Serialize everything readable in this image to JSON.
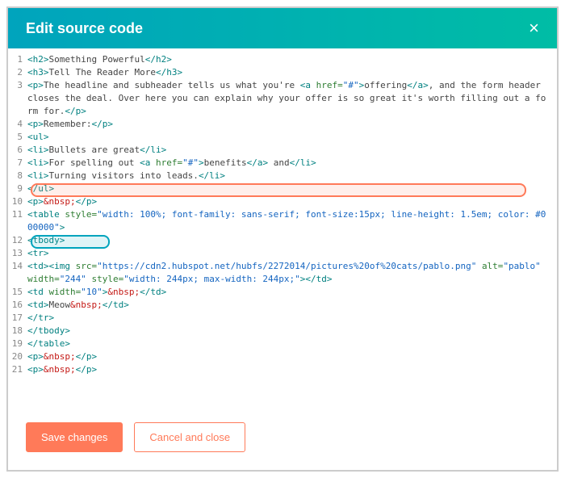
{
  "header": {
    "title": "Edit source code",
    "closeGlyph": "×"
  },
  "buttons": {
    "save": "Save changes",
    "cancel": "Cancel and close"
  },
  "code": {
    "lines": [
      {
        "n": "1",
        "tokens": [
          {
            "c": "t-tag",
            "t": "<h2>"
          },
          {
            "c": "t-text",
            "t": "Something Powerful"
          },
          {
            "c": "t-tag",
            "t": "</h2>"
          }
        ]
      },
      {
        "n": "2",
        "tokens": [
          {
            "c": "t-tag",
            "t": "<h3>"
          },
          {
            "c": "t-text",
            "t": "Tell The Reader More"
          },
          {
            "c": "t-tag",
            "t": "</h3>"
          }
        ]
      },
      {
        "n": "3",
        "tokens": [
          {
            "c": "t-tag",
            "t": "<p>"
          },
          {
            "c": "t-text",
            "t": "The headline and subheader tells us what you're "
          },
          {
            "c": "t-tag",
            "t": "<a "
          },
          {
            "c": "t-attr",
            "t": "href="
          },
          {
            "c": "t-val",
            "t": "\"#\""
          },
          {
            "c": "t-tag",
            "t": ">"
          },
          {
            "c": "t-text",
            "t": "offering"
          },
          {
            "c": "t-tag",
            "t": "</a>"
          },
          {
            "c": "t-text",
            "t": ", and the form header closes the deal. Over here you can explain why your offer is so great it's worth filling out a form for."
          },
          {
            "c": "t-tag",
            "t": "</p>"
          }
        ]
      },
      {
        "n": "4",
        "tokens": [
          {
            "c": "t-tag",
            "t": "<p>"
          },
          {
            "c": "t-text",
            "t": "Remember:"
          },
          {
            "c": "t-tag",
            "t": "</p>"
          }
        ]
      },
      {
        "n": "5",
        "tokens": [
          {
            "c": "t-tag",
            "t": "<ul>"
          }
        ]
      },
      {
        "n": "6",
        "tokens": [
          {
            "c": "t-tag",
            "t": "<li>"
          },
          {
            "c": "t-text",
            "t": "Bullets are great"
          },
          {
            "c": "t-tag",
            "t": "</li>"
          }
        ]
      },
      {
        "n": "7",
        "tokens": [
          {
            "c": "t-tag",
            "t": "<li>"
          },
          {
            "c": "t-text",
            "t": "For spelling out "
          },
          {
            "c": "t-tag",
            "t": "<a "
          },
          {
            "c": "t-attr",
            "t": "href="
          },
          {
            "c": "t-val",
            "t": "\"#\""
          },
          {
            "c": "t-tag",
            "t": ">"
          },
          {
            "c": "t-text",
            "t": "benefits"
          },
          {
            "c": "t-tag",
            "t": "</a>"
          },
          {
            "c": "t-text",
            "t": " and"
          },
          {
            "c": "t-tag",
            "t": "</li>"
          }
        ]
      },
      {
        "n": "8",
        "tokens": [
          {
            "c": "t-tag",
            "t": "<li>"
          },
          {
            "c": "t-text",
            "t": "Turning visitors into leads."
          },
          {
            "c": "t-tag",
            "t": "</li>"
          }
        ]
      },
      {
        "n": "9",
        "tokens": [
          {
            "c": "t-tag",
            "t": "</ul>"
          }
        ]
      },
      {
        "n": "10",
        "tokens": [
          {
            "c": "t-tag",
            "t": "<p>"
          },
          {
            "c": "t-str",
            "t": "&nbsp;"
          },
          {
            "c": "t-tag",
            "t": "</p>"
          }
        ]
      },
      {
        "n": "11",
        "tokens": [
          {
            "c": "t-tag",
            "t": "<table "
          },
          {
            "c": "t-attr",
            "t": "style="
          },
          {
            "c": "t-val",
            "t": "\"width: 100%; font-family: sans-serif; font-size:15px; line-height: 1.5em; color: #000000\""
          },
          {
            "c": "t-tag",
            "t": ">"
          }
        ]
      },
      {
        "n": "12",
        "tokens": [
          {
            "c": "t-tag",
            "t": "<tbody>"
          }
        ]
      },
      {
        "n": "13",
        "tokens": [
          {
            "c": "t-tag",
            "t": "<tr>"
          }
        ]
      },
      {
        "n": "14",
        "tokens": [
          {
            "c": "t-tag",
            "t": "<td><img "
          },
          {
            "c": "t-attr",
            "t": "src="
          },
          {
            "c": "t-val",
            "t": "\"https://cdn2.hubspot.net/hubfs/2272014/pictures%20of%20cats/pablo.png\""
          },
          {
            "c": "t-text",
            "t": " "
          },
          {
            "c": "t-attr",
            "t": "alt="
          },
          {
            "c": "t-val",
            "t": "\"pablo\""
          },
          {
            "c": "t-text",
            "t": " "
          },
          {
            "c": "t-attr",
            "t": "width="
          },
          {
            "c": "t-val",
            "t": "\"244\""
          },
          {
            "c": "t-text",
            "t": " "
          },
          {
            "c": "t-attr",
            "t": "style="
          },
          {
            "c": "t-val",
            "t": "\"width: 244px; max-width: 244px;\""
          },
          {
            "c": "t-tag",
            "t": "></td>"
          }
        ]
      },
      {
        "n": "15",
        "tokens": [
          {
            "c": "t-tag",
            "t": "<td "
          },
          {
            "c": "t-attr",
            "t": "width="
          },
          {
            "c": "t-val",
            "t": "\"10\""
          },
          {
            "c": "t-tag",
            "t": ">"
          },
          {
            "c": "t-str",
            "t": "&nbsp;"
          },
          {
            "c": "t-tag",
            "t": "</td>"
          }
        ]
      },
      {
        "n": "16",
        "tokens": [
          {
            "c": "t-tag",
            "t": "<td>"
          },
          {
            "c": "t-text",
            "t": "Meow"
          },
          {
            "c": "t-str",
            "t": "&nbsp;"
          },
          {
            "c": "t-tag",
            "t": "</td>"
          }
        ]
      },
      {
        "n": "17",
        "tokens": [
          {
            "c": "t-tag",
            "t": "</tr>"
          }
        ]
      },
      {
        "n": "18",
        "tokens": [
          {
            "c": "t-tag",
            "t": "</tbody>"
          }
        ]
      },
      {
        "n": "19",
        "tokens": [
          {
            "c": "t-tag",
            "t": "</table>"
          }
        ]
      },
      {
        "n": "20",
        "tokens": [
          {
            "c": "t-tag",
            "t": "<p>"
          },
          {
            "c": "t-str",
            "t": "&nbsp;"
          },
          {
            "c": "t-tag",
            "t": "</p>"
          }
        ]
      },
      {
        "n": "21",
        "tokens": [
          {
            "c": "t-tag",
            "t": "<p>"
          },
          {
            "c": "t-str",
            "t": "&nbsp;"
          },
          {
            "c": "t-tag",
            "t": "</p>"
          }
        ]
      }
    ]
  }
}
